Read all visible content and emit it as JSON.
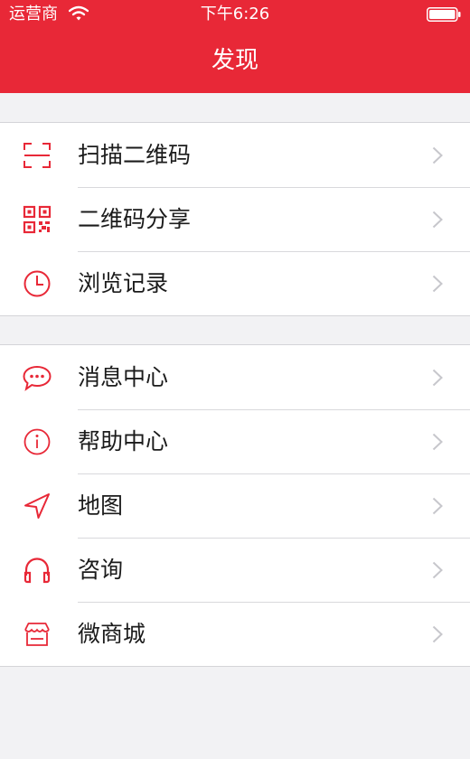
{
  "status_bar": {
    "carrier": "运营商",
    "time": "下午6:26"
  },
  "nav": {
    "title": "发现"
  },
  "groups": [
    {
      "items": [
        {
          "label": "扫描二维码",
          "icon": "scan-qr-icon"
        },
        {
          "label": "二维码分享",
          "icon": "qr-code-icon"
        },
        {
          "label": "浏览记录",
          "icon": "clock-icon"
        }
      ]
    },
    {
      "items": [
        {
          "label": "消息中心",
          "icon": "chat-bubble-icon"
        },
        {
          "label": "帮助中心",
          "icon": "info-icon"
        },
        {
          "label": "地图",
          "icon": "location-arrow-icon"
        },
        {
          "label": "咨询",
          "icon": "headphones-icon"
        },
        {
          "label": "微商城",
          "icon": "store-icon"
        }
      ]
    }
  ],
  "colors": {
    "accent": "#e82837",
    "background": "#f2f2f4",
    "chevron": "#c7c7cc"
  }
}
